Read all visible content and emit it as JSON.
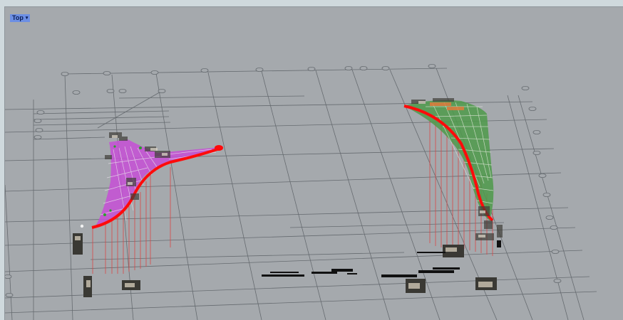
{
  "viewport": {
    "name": "Top",
    "menu_icon": "dropdown-arrow-icon",
    "background": "#a5a9ad",
    "grid_color": "#6b7075",
    "surface_left_color": "#c64fd6",
    "surface_right_color": "#4e9a4a",
    "edge_curve_color": "#ff0b0b"
  }
}
